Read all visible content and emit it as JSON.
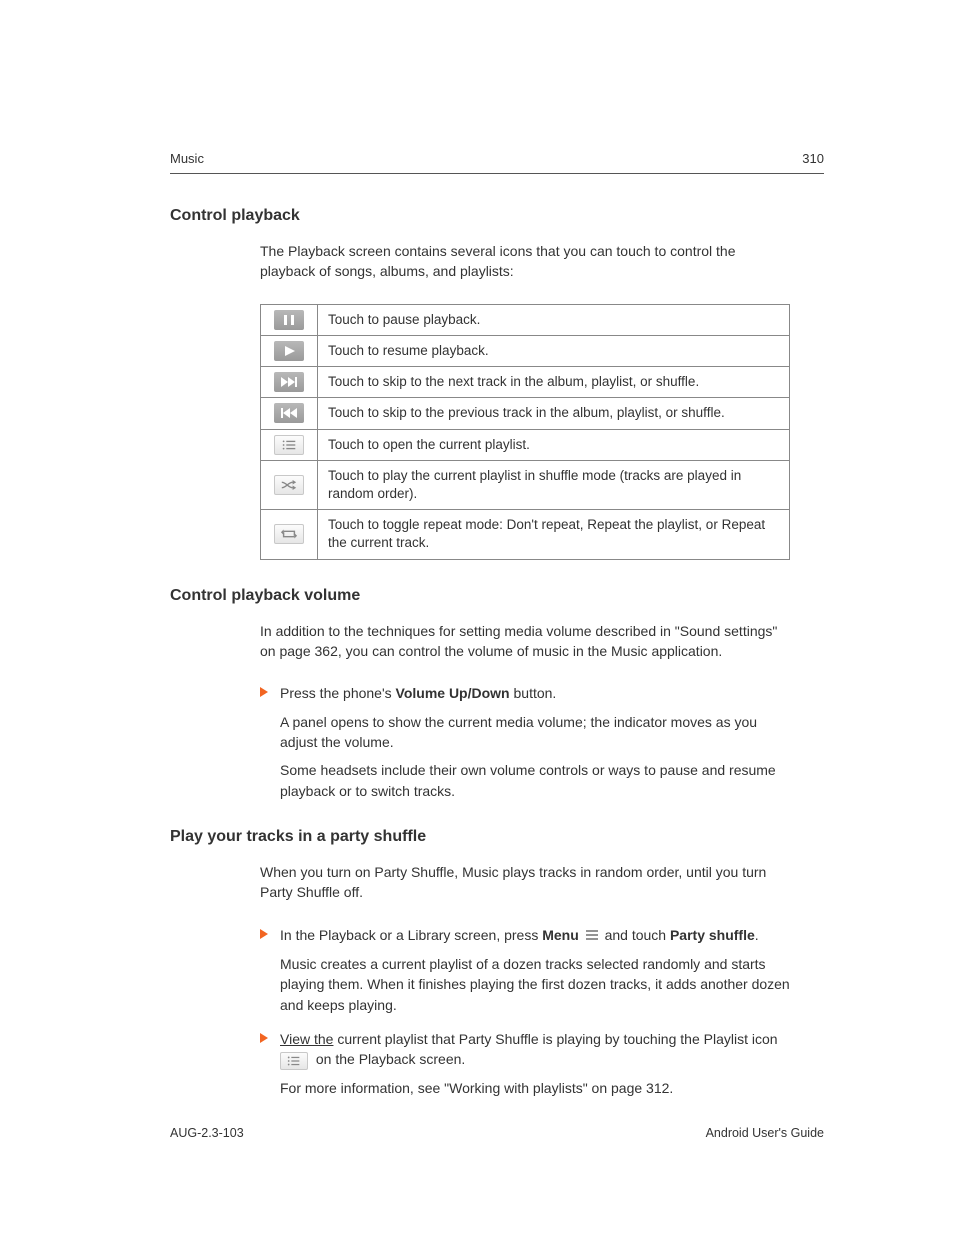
{
  "header": {
    "left": "Music",
    "right": "310"
  },
  "section1": {
    "heading": "Control playback",
    "intro": "The Playback screen contains several icons that you can touch to control the playback of songs, albums, and playlists:"
  },
  "icon_table": [
    {
      "name": "pause-icon",
      "style": "dark",
      "desc": "Touch to pause playback."
    },
    {
      "name": "play-icon",
      "style": "dark",
      "desc": "Touch to resume playback."
    },
    {
      "name": "next-icon",
      "style": "dark",
      "desc": "Touch to skip to the next track in the album, playlist, or shuffle."
    },
    {
      "name": "prev-icon",
      "style": "dark",
      "desc": "Touch to skip to the previous track in the album, playlist, or shuffle."
    },
    {
      "name": "playlist-icon",
      "style": "light",
      "desc": "Touch to open the current playlist."
    },
    {
      "name": "shuffle-icon",
      "style": "light",
      "desc": "Touch to play the current playlist in shuffle mode (tracks are played in random order)."
    },
    {
      "name": "repeat-icon",
      "style": "light",
      "desc": "Touch to toggle repeat mode: Don't repeat, Repeat the playlist, or Repeat the current track."
    }
  ],
  "section2": {
    "heading": "Control playback volume",
    "intro": "In addition to the techniques for setting media volume described in \"Sound settings\" on page 362, you can control the volume of music in the Music application.",
    "bullet": {
      "lead_a": "Press the phone's ",
      "bold": "Volume Up/Down",
      "lead_b": " button.",
      "sub1": "A panel opens to show the current media volume; the indicator moves as you adjust the volume.",
      "sub2": "Some headsets include their own volume controls or ways to pause and resume playback or to switch tracks."
    }
  },
  "section3": {
    "heading": "Play your tracks in a party shuffle",
    "intro": "When you turn on Party Shuffle, Music plays tracks in random order, until you turn Party Shuffle off.",
    "bullet1": {
      "a": "In the Playback or a Library screen, press ",
      "menu_bold": "Menu",
      "b": " and touch ",
      "party_bold": "Party shuffle",
      "c": ".",
      "sub": "Music creates a current playlist of a dozen tracks selected randomly and starts playing them. When it finishes playing the first dozen tracks, it adds another dozen and keeps playing."
    },
    "bullet2": {
      "a_underline": "View the",
      "a_rest": " current playlist that Party Shuffle is playing by touching the Playlist icon ",
      "b": " on the Playback screen.",
      "sub": "For more information, see \"Working with playlists\" on page 312."
    }
  },
  "footer": {
    "left": "AUG-2.3-103",
    "right": "Android User's Guide"
  }
}
